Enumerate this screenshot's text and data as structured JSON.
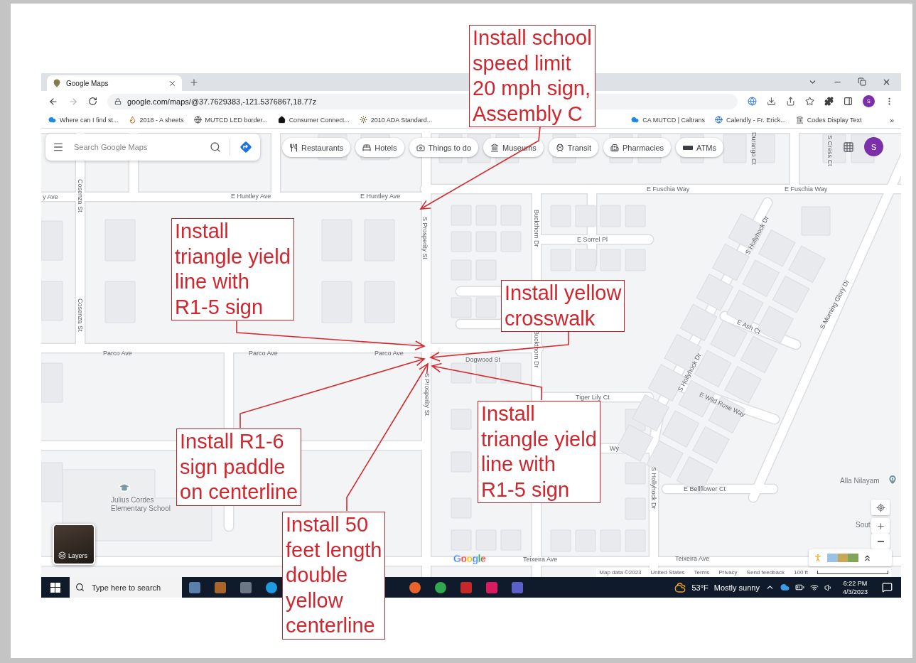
{
  "browser": {
    "tab": {
      "title": "Google Maps"
    },
    "url": "google.com/maps/@37.7629383,-121.5376867,18.77z",
    "profile_initial": "S",
    "bookmarks": [
      "Where can I find st...",
      "2018 - A sheets",
      "MUTCD LED border...",
      "Consumer Connect...",
      "2010 ADA Standard...",
      "CA MUTCD | Caltrans",
      "Calendly - Fr. Erick...",
      "Codes Display Text"
    ],
    "bookmarks_overflow": "»"
  },
  "map": {
    "search": {
      "placeholder": "Search Google Maps"
    },
    "categories": [
      "Restaurants",
      "Hotels",
      "Things to do",
      "Museums",
      "Transit",
      "Pharmacies",
      "ATMs"
    ],
    "account_initial": "S",
    "street_labels": [
      "y Ave",
      "Cosenza St",
      "E Huntley Ave",
      "E Huntley Ave",
      "E Fuschia Way",
      "E Fuschia Way",
      "Durango Ct",
      "S Cress Ct",
      "S Prosperity St",
      "Buckthorn Dr",
      "E Sorrel Pl",
      "S Hollyhock Dr",
      "S Morning Glory Dr",
      "Cosenza St",
      "E Ash Ct",
      "Parco Ave",
      "Parco Ave",
      "Parco Ave",
      "Dogwood St",
      "Buckthorn Dr",
      "S Hollyhock Dr",
      "S Prosperity St",
      "Tiger Lily Ct",
      "E Wild Rose Way",
      "Wy",
      "S Hollyhock Dr",
      "E Bellflower Ct",
      "Teixeira Ave",
      "Teixeira Ave"
    ],
    "places": [
      "Julius Cordes Elementary School",
      "Alla Nilayam"
    ],
    "partial_label": "Sout",
    "logo": "Google",
    "layers_label": "Layers",
    "footer": [
      "Map data ©2023",
      "United States",
      "Terms",
      "Privacy",
      "Send feedback"
    ],
    "scale": "100 ft"
  },
  "taskbar": {
    "search_placeholder": "Type here to search",
    "temperature": "53°F",
    "weather": "Mostly sunny",
    "time": "6:22 PM",
    "date": "4/3/2023"
  },
  "callouts": [
    {
      "text": "Install school\nspeed limit\n20 mph sign,\nAssembly C"
    },
    {
      "text": "Install\ntriangle yield\nline with\nR1-5 sign"
    },
    {
      "text": "Install yellow\ncrosswalk"
    },
    {
      "text": "Install R1-6\nsign paddle\non centerline"
    },
    {
      "text": "Install 50\nfeet length\ndouble\nyellow\ncenterline"
    },
    {
      "text": "Install\ntriangle yield\nline with\nR1-5 sign"
    }
  ]
}
